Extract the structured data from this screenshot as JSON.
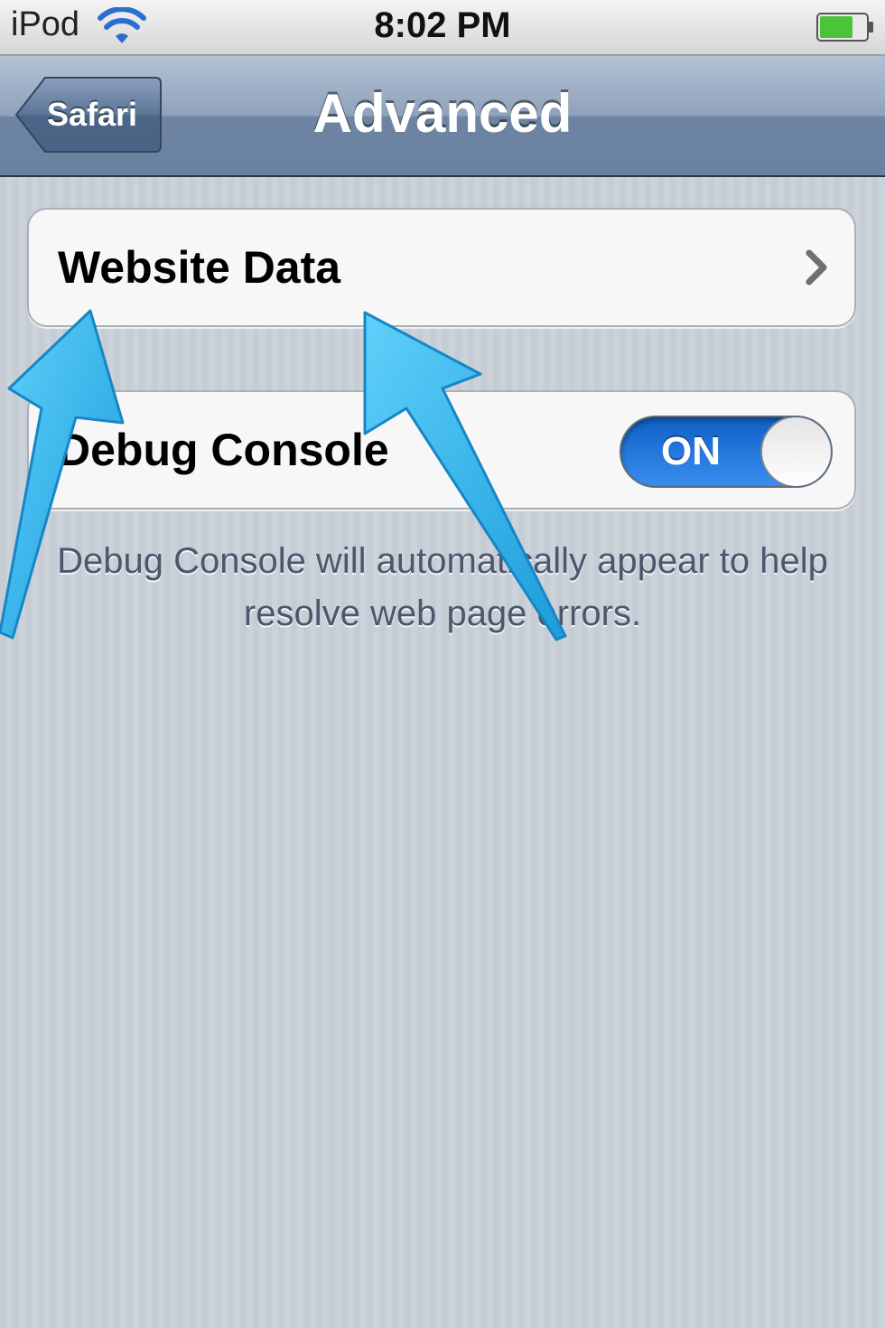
{
  "status_bar": {
    "carrier": "iPod",
    "time": "8:02 PM"
  },
  "nav_bar": {
    "back_label": "Safari",
    "title": "Advanced"
  },
  "settings": {
    "website_data_label": "Website Data",
    "debug_console_label": "Debug Console",
    "debug_console_toggle": "ON",
    "footer_note": "Debug Console will automatically appear to help resolve web page errors."
  },
  "colors": {
    "accent_toggle": "#1a6fdc",
    "annotation_arrow": "#29aee8"
  },
  "icons": [
    "wifi-icon",
    "battery-icon",
    "chevron-right-icon",
    "arrow-annotation"
  ]
}
